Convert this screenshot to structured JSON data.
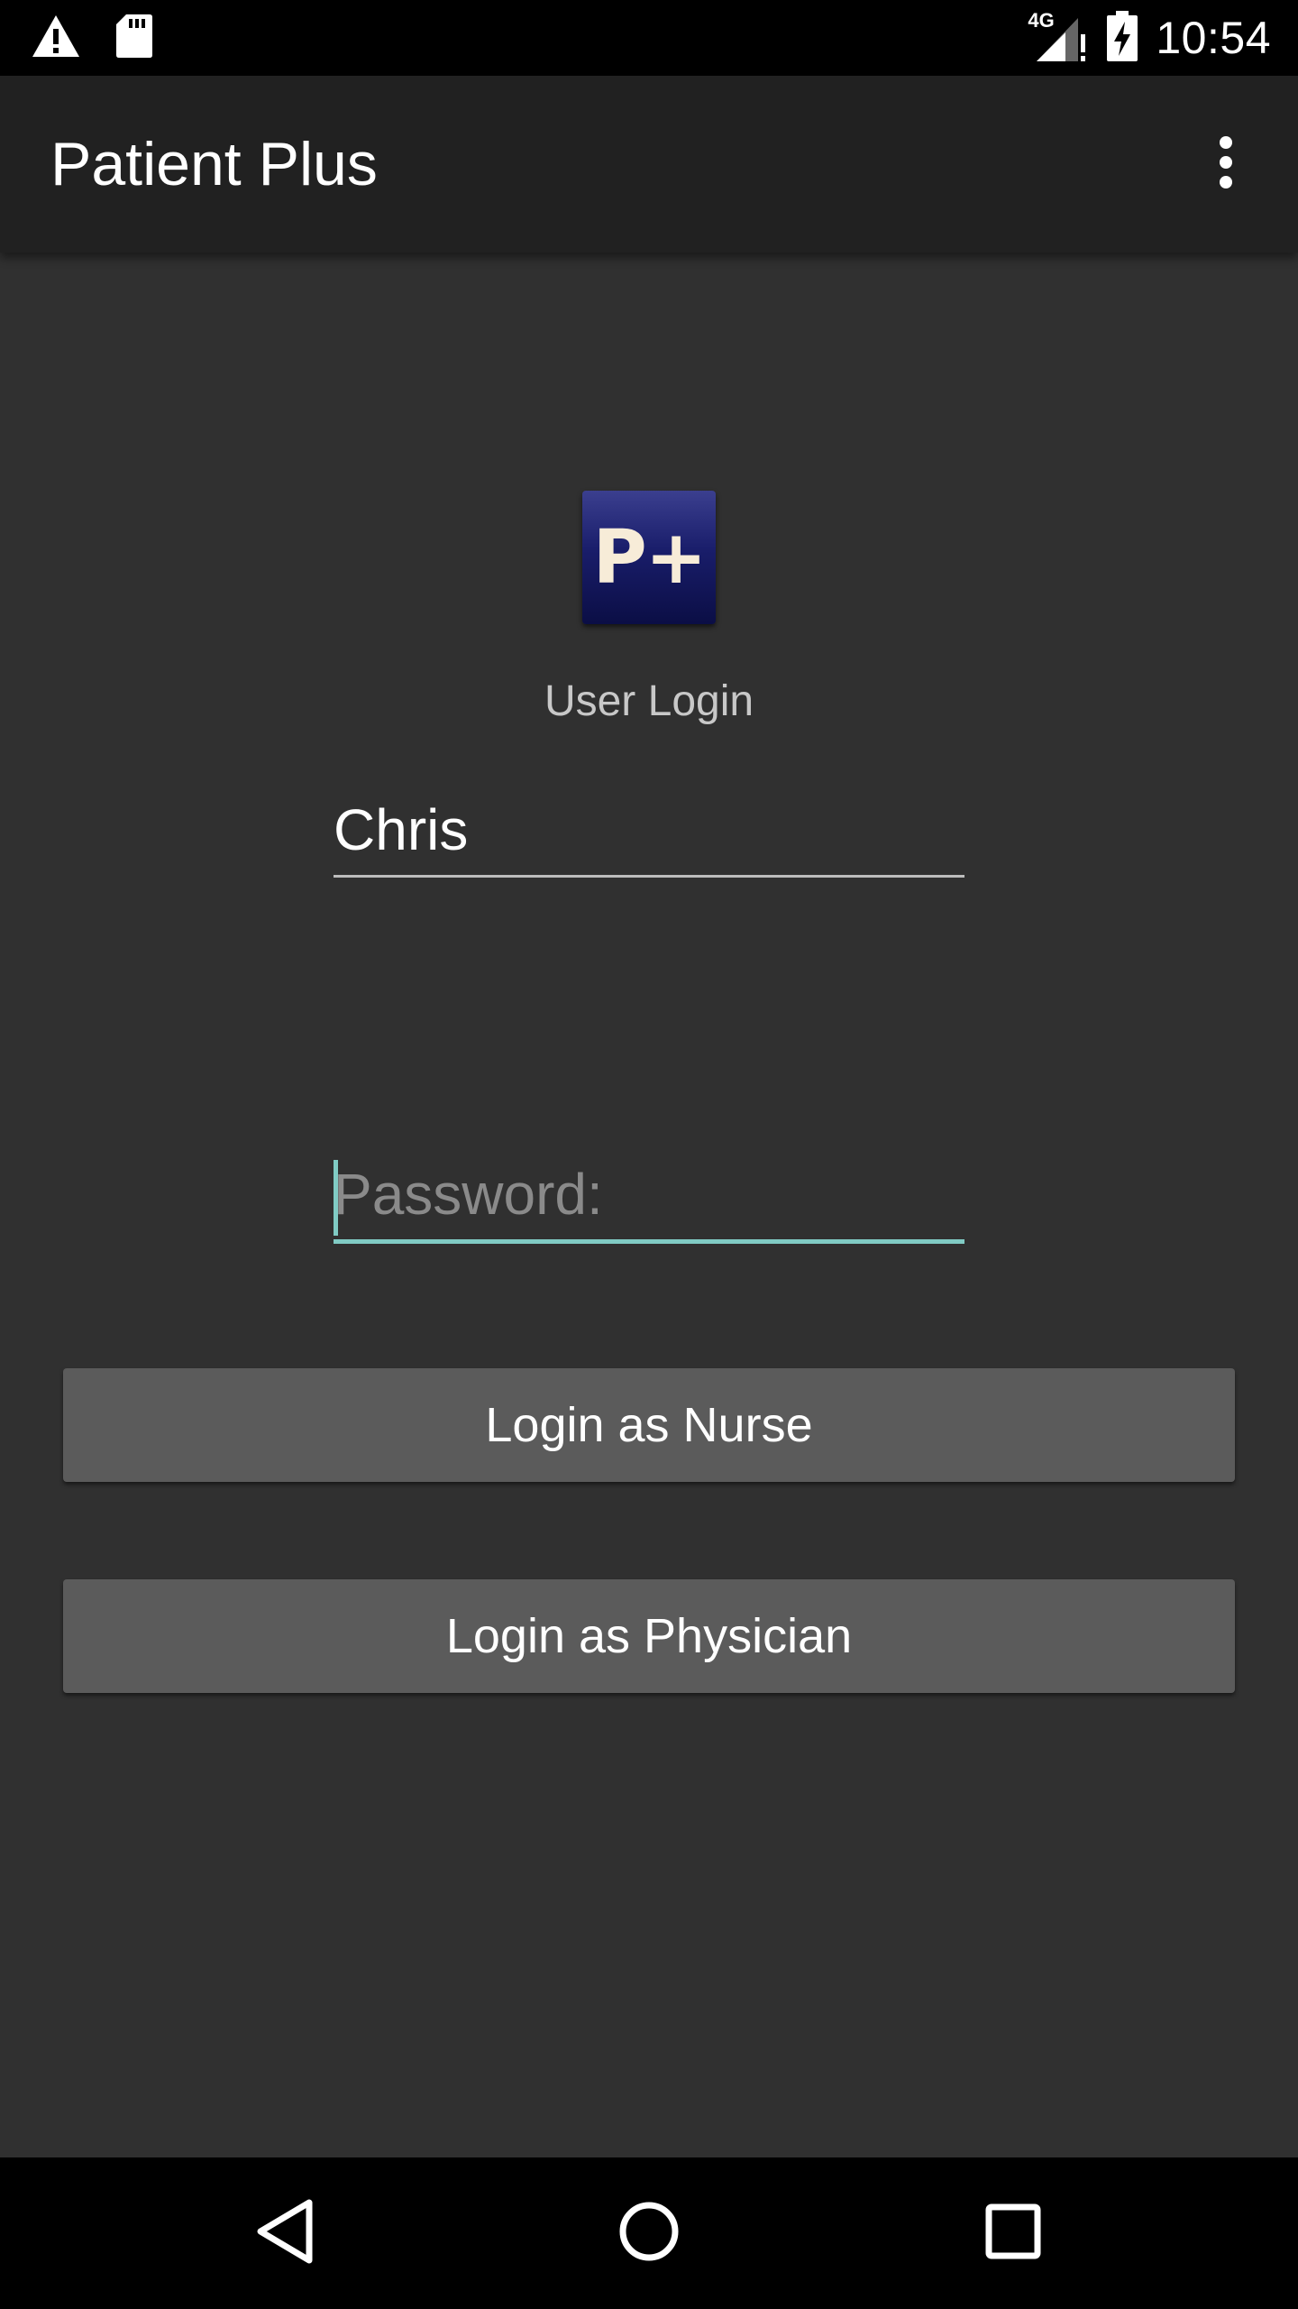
{
  "status_bar": {
    "time": "10:54",
    "network_label": "4G",
    "icons": [
      "warning-icon",
      "sd-card-icon",
      "signal-icon",
      "battery-charging-icon"
    ]
  },
  "app_bar": {
    "title": "Patient Plus",
    "menu_icon": "overflow-menu-icon"
  },
  "login": {
    "logo_text": "P+",
    "heading": "User Login",
    "username": {
      "value": "Chris",
      "placeholder": ""
    },
    "password": {
      "value": "",
      "placeholder": "Password:"
    },
    "nurse_button_label": "Login as Nurse",
    "physician_button_label": "Login as Physician"
  },
  "nav_bar": {
    "icons": [
      "back-icon",
      "home-icon",
      "recents-icon"
    ]
  },
  "colors": {
    "background": "#303030",
    "app_bar": "#212121",
    "button": "#5b5b5b",
    "accent": "#80cbc4",
    "logo": "#191d6a"
  }
}
